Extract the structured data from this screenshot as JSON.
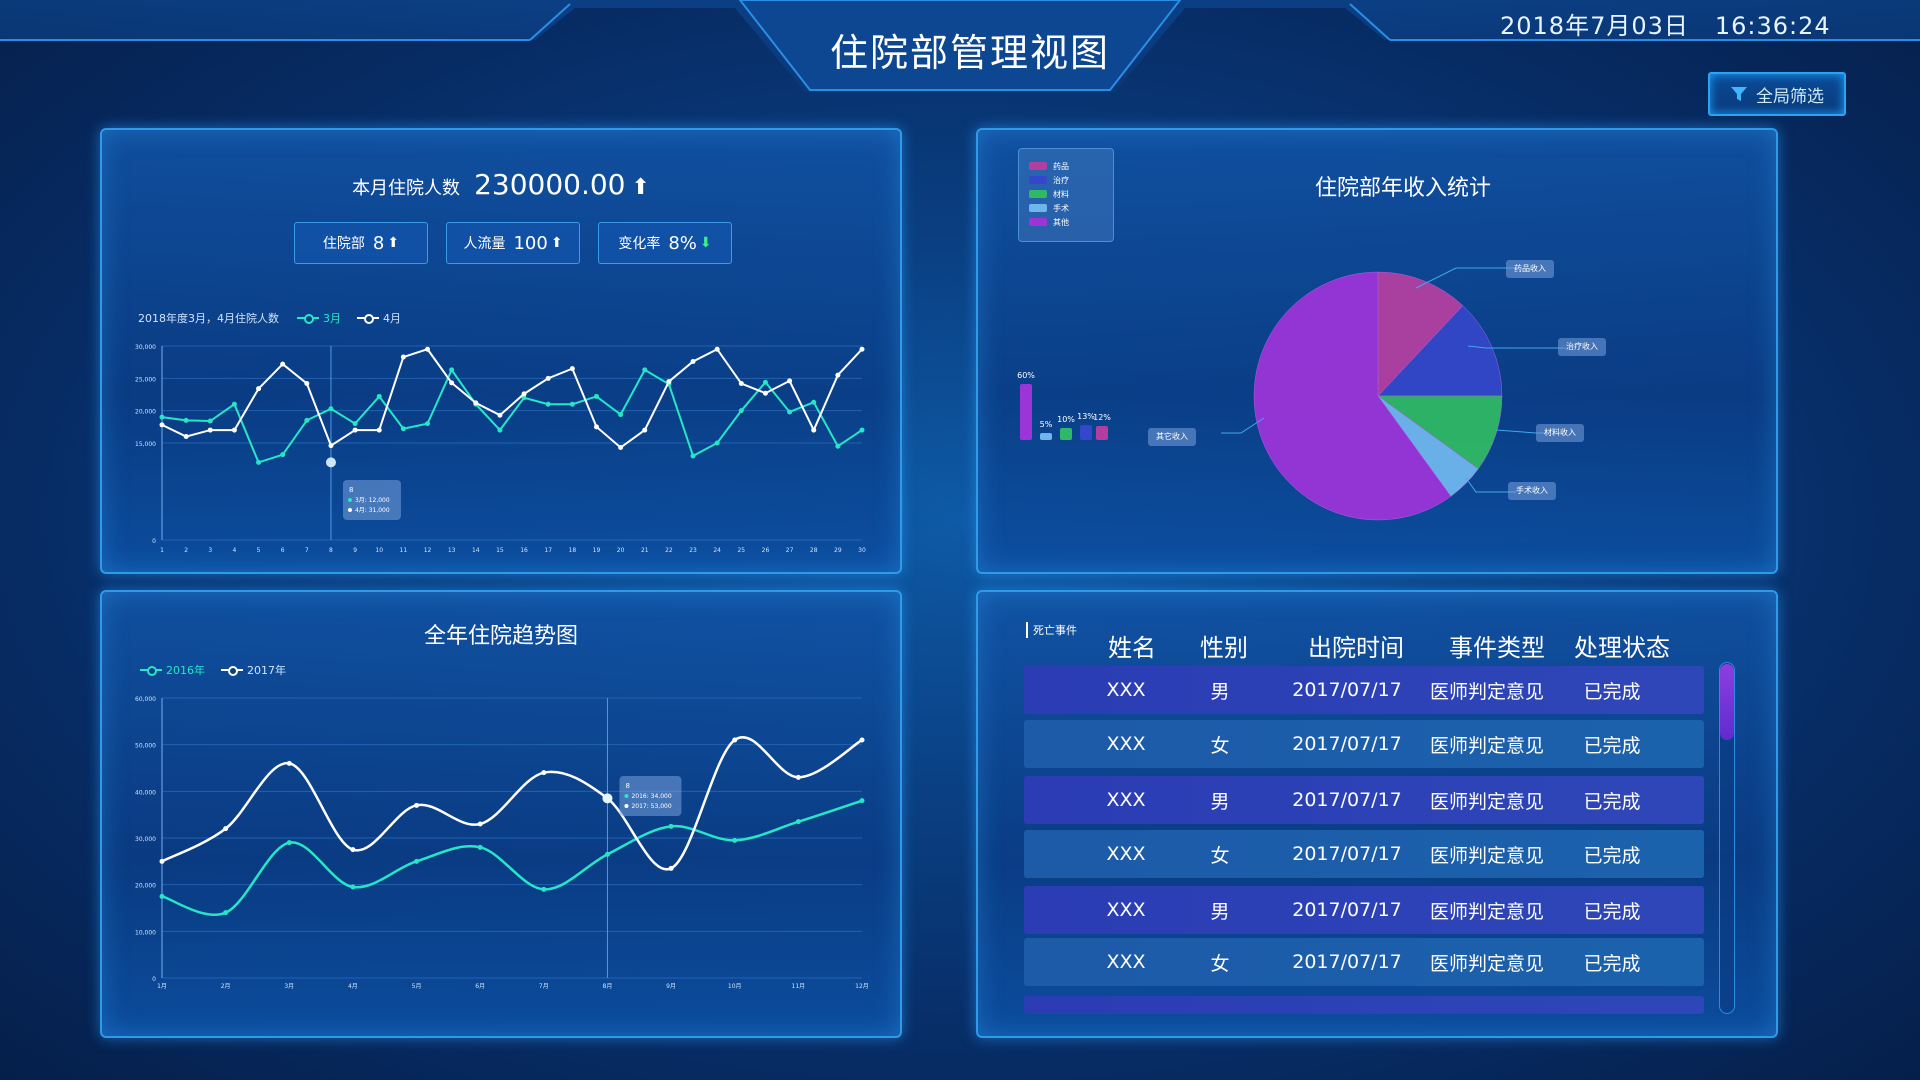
{
  "header": {
    "title": "住院部管理视图",
    "date": "2018年7月03日",
    "time": "16:36:24",
    "filter_label": "全局筛选"
  },
  "monthly_panel": {
    "stat_label": "本月住院人数",
    "stat_value": "230000.00",
    "kpis": [
      {
        "label": "住院部",
        "value": "8",
        "trend": "up"
      },
      {
        "label": "人流量",
        "value": "100",
        "trend": "up"
      },
      {
        "label": "变化率",
        "value": "8%",
        "trend": "down"
      }
    ],
    "chart_caption": "2018年度3月，4月住院人数",
    "tooltip": {
      "title": "8",
      "line1": "3月: 12,000",
      "line2": "4月: 31,000"
    }
  },
  "income_panel": {
    "title": "住院部年收入统计",
    "legend": [
      "药品",
      "治疗",
      "材料",
      "手术",
      "其他"
    ],
    "labels": {
      "drug": "药品收入",
      "treatment": "治疗收入",
      "material": "材料收入",
      "surgery": "手术收入",
      "other": "其它收入"
    }
  },
  "trend_panel": {
    "title": "全年住院趋势图",
    "tooltip": {
      "title": "8",
      "line1": "2016: 34,000",
      "line2": "2017: 53,000"
    }
  },
  "death_panel": {
    "caption": "死亡事件",
    "columns": [
      "姓名",
      "性别",
      "出院时间",
      "事件类型",
      "处理状态"
    ],
    "rows": [
      [
        "XXX",
        "男",
        "2017/07/17",
        "医师判定意见",
        "已完成"
      ],
      [
        "XXX",
        "女",
        "2017/07/17",
        "医师判定意见",
        "已完成"
      ],
      [
        "XXX",
        "男",
        "2017/07/17",
        "医师判定意见",
        "已完成"
      ],
      [
        "XXX",
        "女",
        "2017/07/17",
        "医师判定意见",
        "已完成"
      ],
      [
        "XXX",
        "男",
        "2017/07/17",
        "医师判定意见",
        "已完成"
      ],
      [
        "XXX",
        "女",
        "2017/07/17",
        "医师判定意见",
        "已完成"
      ]
    ]
  },
  "colors": {
    "cyan": "#27e6c8",
    "white": "#ffffff",
    "pie_main": "#9b35d8",
    "accent_border": "#2f9be8"
  },
  "chart_data": [
    {
      "type": "line",
      "title": "",
      "xlabel": "",
      "ylabel": "",
      "x": [
        1,
        2,
        3,
        4,
        5,
        6,
        7,
        8,
        9,
        10,
        11,
        12,
        13,
        14,
        15,
        16,
        17,
        18,
        19,
        20,
        21,
        22,
        23,
        24,
        25,
        26,
        27,
        28,
        29,
        30
      ],
      "yticks": [
        "0",
        "15,000",
        "20,000",
        "25,000",
        "30,000"
      ],
      "ylim": [
        0,
        30000
      ],
      "legend_position": "top",
      "series": [
        {
          "name": "3月",
          "color": "#27e6c8",
          "values": [
            19000,
            18500,
            18400,
            21000,
            12000,
            13200,
            18500,
            20300,
            18000,
            22200,
            17200,
            18000,
            26300,
            21000,
            17000,
            22000,
            21000,
            21000,
            22200,
            19400,
            26300,
            24100,
            13000,
            15000,
            20000,
            24400,
            19800,
            21300,
            14500,
            17000
          ]
        },
        {
          "name": "4月",
          "color": "#ffffff",
          "values": [
            17800,
            16000,
            17000,
            17000,
            23400,
            27200,
            24200,
            14600,
            17000,
            17000,
            28300,
            29500,
            24300,
            21200,
            19300,
            22600,
            25000,
            26500,
            17500,
            14300,
            17000,
            24500,
            27600,
            29500,
            24200,
            22700,
            24600,
            17000,
            25500,
            29500
          ]
        }
      ]
    },
    {
      "type": "line",
      "title": "全年住院趋势图",
      "xlabel": "",
      "ylabel": "",
      "categories": [
        "1月",
        "2月",
        "3月",
        "4月",
        "5月",
        "6月",
        "7月",
        "8月",
        "9月",
        "10月",
        "11月",
        "12月"
      ],
      "ylim": [
        0,
        60000
      ],
      "yticks": [
        "0",
        "10,000",
        "20,000",
        "30,000",
        "40,000",
        "50,000",
        "60,000"
      ],
      "legend_position": "top-left",
      "series": [
        {
          "name": "2016年",
          "color": "#27e6c8",
          "values": [
            17500,
            14000,
            29000,
            19500,
            25000,
            28000,
            19000,
            26500,
            32500,
            29500,
            33500,
            38000
          ]
        },
        {
          "name": "2017年",
          "color": "#ffffff",
          "values": [
            25000,
            32000,
            46000,
            27500,
            37000,
            33000,
            44000,
            38500,
            23500,
            51000,
            43000,
            51000
          ]
        }
      ]
    },
    {
      "type": "pie",
      "title": "住院部年收入统计",
      "categories": [
        "药品",
        "治疗",
        "材料",
        "手术",
        "其他"
      ],
      "values": [
        12,
        13,
        10,
        5,
        60
      ],
      "colors": [
        "#b23fa0",
        "#3447c8",
        "#2fb865",
        "#6fb6ee",
        "#9b35d8"
      ],
      "bar_labels": [
        "60%",
        "5%",
        "10%",
        "13%",
        "12%"
      ]
    }
  ]
}
